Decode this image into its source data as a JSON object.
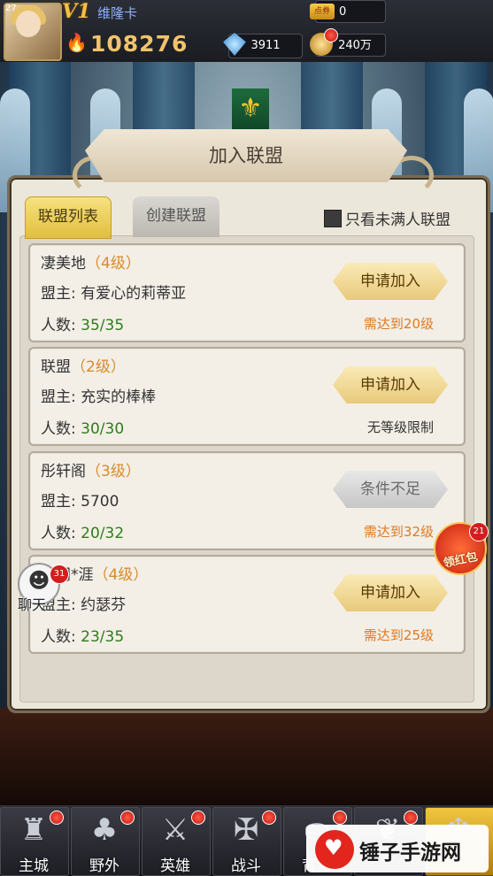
{
  "player": {
    "level": "27",
    "vip": "V1",
    "name": "维隆卡",
    "power": "108276"
  },
  "resources": {
    "tickets": "0",
    "tickets_label": "点券",
    "diamonds": "3911",
    "gold": "240万"
  },
  "panel": {
    "title": "加入联盟",
    "tabs": [
      "联盟列表",
      "创建联盟"
    ],
    "active_tab": "联盟列表",
    "filter_label": "只看未满人联盟",
    "filter_checked": false
  },
  "alliances": [
    {
      "name": "凄美地",
      "level": "（4级）",
      "leader_label": "盟主: ",
      "leader": "有爱心的莉蒂亚",
      "count_label": "人数: ",
      "count": "35/35",
      "button": "申请加入",
      "enabled": true,
      "requirement": "需达到20级",
      "req_plain": false
    },
    {
      "name": "联盟",
      "level": "（2级）",
      "leader_label": "盟主: ",
      "leader": "充实的棒棒",
      "count_label": "人数: ",
      "count": "30/30",
      "button": "申请加入",
      "enabled": true,
      "requirement": "无等级限制",
      "req_plain": true
    },
    {
      "name": "彤轩阁",
      "level": "（3级）",
      "leader_label": "盟主: ",
      "leader": "5700",
      "count_label": "人数: ",
      "count": "20/32",
      "button": "条件不足",
      "enabled": false,
      "requirement": "需达到32级",
      "req_plain": false
    },
    {
      "name": "高阔*涯",
      "level": "（4级）",
      "leader_label": "盟主: ",
      "leader": "约瑟芬",
      "count_label": "人数: ",
      "count": "23/35",
      "button": "申请加入",
      "enabled": true,
      "requirement": "需达到25级",
      "req_plain": false
    }
  ],
  "floating": {
    "red_packet_label": "领红包",
    "red_packet_badge": "21",
    "chat_label": "聊天",
    "chat_badge": "31"
  },
  "nav": [
    {
      "label": "主城",
      "icon": "castle-icon",
      "glyph": "♜"
    },
    {
      "label": "野外",
      "icon": "tree-icon",
      "glyph": "♣"
    },
    {
      "label": "英雄",
      "icon": "hero-icon",
      "glyph": "⚔"
    },
    {
      "label": "战斗",
      "icon": "sword-icon",
      "glyph": "✠"
    },
    {
      "label": "背包",
      "icon": "bag-icon",
      "glyph": "⛀"
    },
    {
      "label": "",
      "icon": "wings-icon",
      "glyph": "❦"
    },
    {
      "label": "",
      "icon": "trident-icon",
      "glyph": "♆"
    }
  ],
  "watermark": "锤子手游网",
  "colors": {
    "accent_gold": "#e2be40",
    "requirement_orange": "#e0791f",
    "count_green": "#2e7d1a",
    "badge_red": "#d21e1e"
  }
}
